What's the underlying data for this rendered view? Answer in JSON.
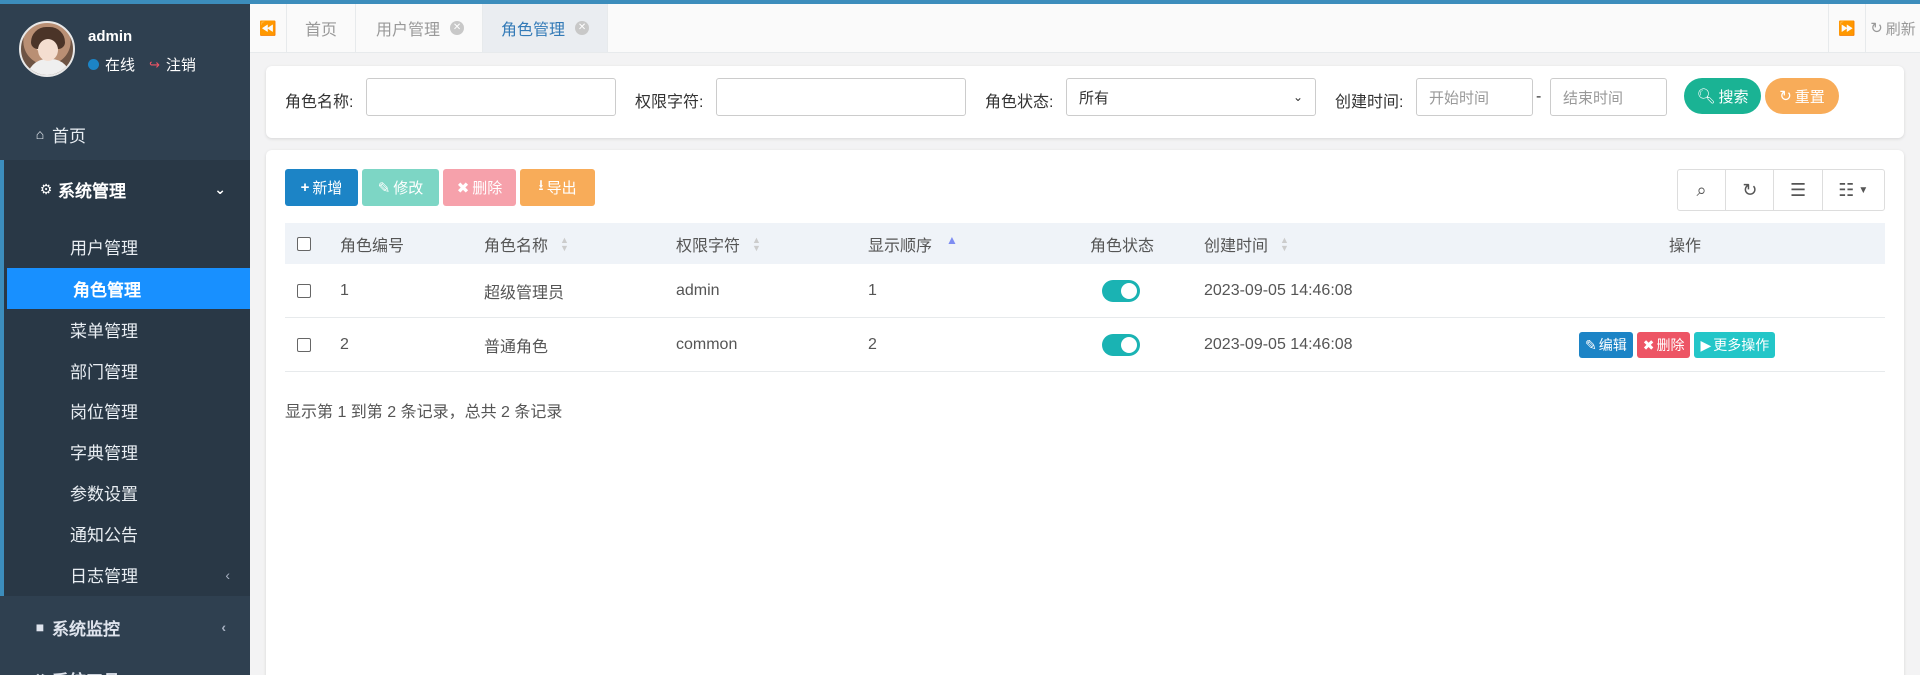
{
  "user": {
    "name": "admin",
    "status": "在线",
    "logout": "注销"
  },
  "nav": {
    "home": "首页",
    "system": "系统管理",
    "submenu": [
      "用户管理",
      "角色管理",
      "菜单管理",
      "部门管理",
      "岗位管理",
      "字典管理",
      "参数设置",
      "通知公告",
      "日志管理"
    ],
    "monitor": "系统监控",
    "tools": "系统工具"
  },
  "tabs": [
    "首页",
    "用户管理",
    "角色管理"
  ],
  "tabbar": {
    "refresh": "刷新"
  },
  "search": {
    "role_name_label": "角色名称:",
    "role_key_label": "权限字符:",
    "status_label": "角色状态:",
    "status_value": "所有",
    "created_label": "创建时间:",
    "start_placeholder": "开始时间",
    "dash": "-",
    "end_placeholder": "结束时间",
    "search_btn": "搜索",
    "reset_btn": "重置"
  },
  "toolbar": {
    "add": "新增",
    "edit": "修改",
    "delete": "删除",
    "export": "导出"
  },
  "table": {
    "columns": [
      "角色编号",
      "角色名称",
      "权限字符",
      "显示顺序",
      "角色状态",
      "创建时间",
      "操作"
    ],
    "rows": [
      {
        "id": "1",
        "name": "超级管理员",
        "key": "admin",
        "order": "1",
        "enabled": true,
        "created": "2023-09-05 14:46:08"
      },
      {
        "id": "2",
        "name": "普通角色",
        "key": "common",
        "order": "2",
        "enabled": true,
        "created": "2023-09-05 14:46:08"
      }
    ],
    "actions": {
      "edit": "编辑",
      "delete": "删除",
      "more": "更多操作"
    }
  },
  "pager": {
    "info": "显示第 1 到第 2 条记录，总共 2 条记录"
  },
  "colors": {
    "sidebar": "#2f4050",
    "active": "#1890ff",
    "primary": "#1c84c6",
    "success": "#1ab394",
    "warning": "#f8ac59",
    "danger": "#ed5565"
  },
  "icons": [
    "search-icon",
    "refresh-icon",
    "columns-icon",
    "grid-icon"
  ]
}
